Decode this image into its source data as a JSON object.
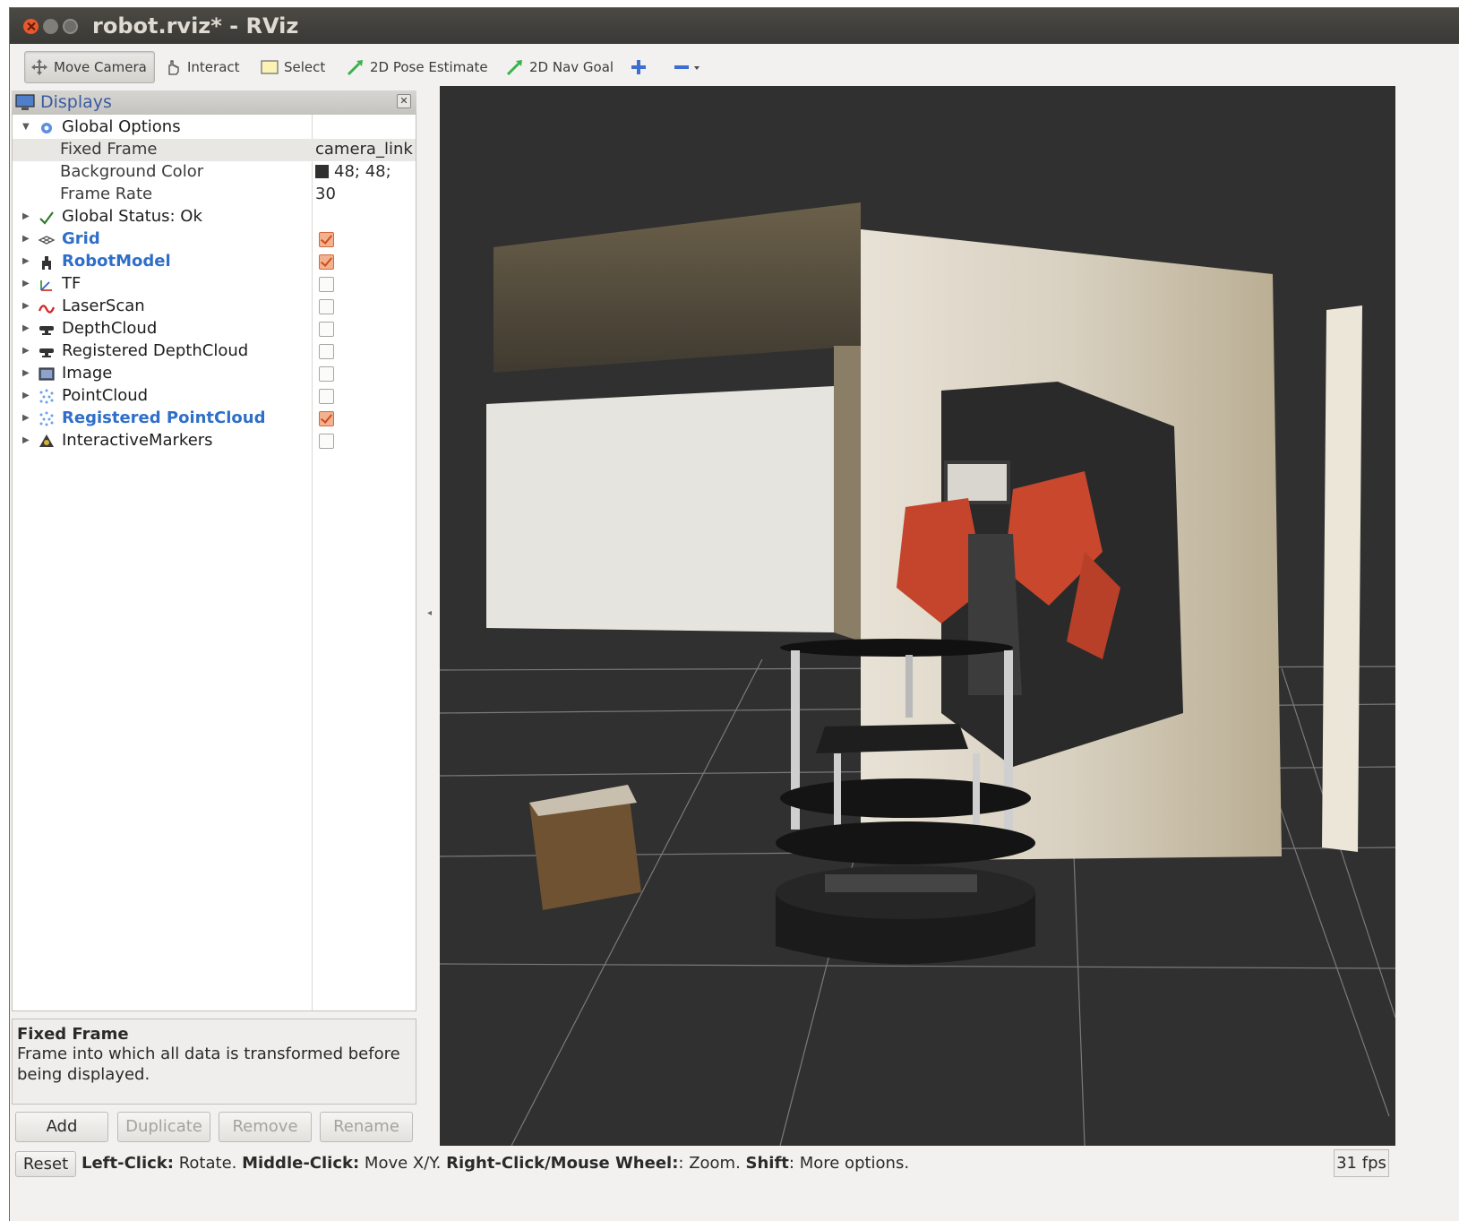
{
  "window": {
    "title": "robot.rviz* - RViz"
  },
  "toolbar": {
    "move_camera": "Move Camera",
    "interact": "Interact",
    "select": "Select",
    "pose_estimate": "2D Pose Estimate",
    "nav_goal": "2D Nav Goal",
    "add_tool_icon": "plus-icon",
    "remove_tool_icon": "minus-icon"
  },
  "displays": {
    "title": "Displays",
    "global_options": "Global Options",
    "fixed_frame_label": "Fixed Frame",
    "fixed_frame_value": "camera_link",
    "background_color_label": "Background Color",
    "background_color_value": "48; 48;",
    "frame_rate_label": "Frame Rate",
    "frame_rate_value": "30",
    "global_status": "Global Status: Ok",
    "items": [
      {
        "name": "Grid",
        "enabled": true
      },
      {
        "name": "RobotModel",
        "enabled": true
      },
      {
        "name": "TF",
        "enabled": false
      },
      {
        "name": "LaserScan",
        "enabled": false
      },
      {
        "name": "DepthCloud",
        "enabled": false
      },
      {
        "name": "Registered DepthCloud",
        "enabled": false
      },
      {
        "name": "Image",
        "enabled": false
      },
      {
        "name": "PointCloud",
        "enabled": false
      },
      {
        "name": "Registered PointCloud",
        "enabled": true
      },
      {
        "name": "InteractiveMarkers",
        "enabled": false
      }
    ]
  },
  "description": {
    "title": "Fixed Frame",
    "text": "Frame into which all data is transformed before being displayed."
  },
  "buttons": {
    "add": "Add",
    "duplicate": "Duplicate",
    "remove": "Remove",
    "rename": "Rename"
  },
  "status": {
    "reset": "Reset",
    "k1": "Left-Click:",
    "v1": " Rotate. ",
    "k2": "Middle-Click:",
    "v2": " Move X/Y. ",
    "k3": "Right-Click/Mouse Wheel:",
    "v3": ": Zoom. ",
    "k4": "Shift",
    "v4": ": More options.",
    "fps": "31 fps"
  },
  "colors": {
    "background": "#303030",
    "accent": "#2f6fc9",
    "checked": "#d6683a"
  }
}
